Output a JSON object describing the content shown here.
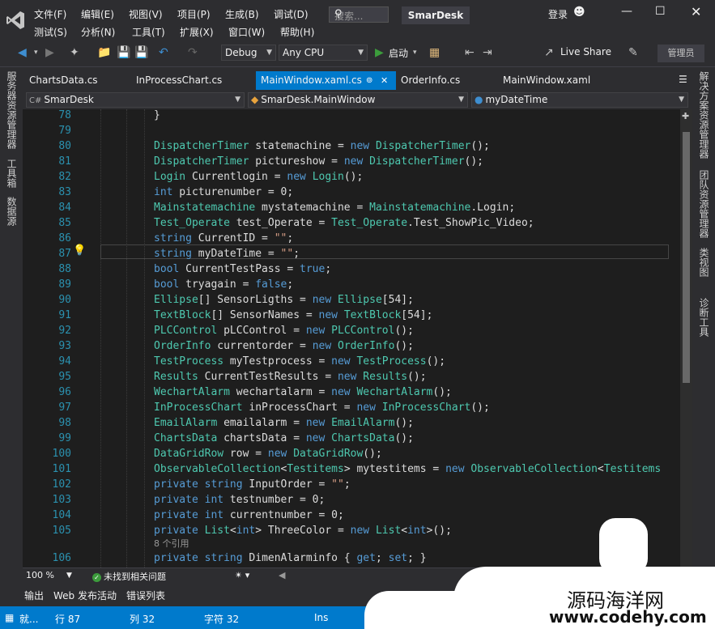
{
  "titlebar": {
    "menu_row1": [
      "文件(F)",
      "编辑(E)",
      "视图(V)",
      "项目(P)",
      "生成(B)",
      "调试(D)"
    ],
    "menu_row2": [
      "测试(S)",
      "分析(N)",
      "工具(T)",
      "扩展(X)",
      "窗口(W)",
      "帮助(H)"
    ],
    "search_placeholder": "搜索...",
    "app_title": "SmarDesk",
    "login": "登录"
  },
  "toolbar": {
    "config": "Debug",
    "platform": "Any CPU",
    "start_label": "启动",
    "live_share": "Live Share",
    "admin": "管理员"
  },
  "left_panels": [
    "服务器资源管理器",
    "工具箱",
    "数据源"
  ],
  "right_panels": [
    "解决方案资源管理器",
    "团队资源管理器",
    "类视图",
    "诊断工具"
  ],
  "tabs": [
    {
      "label": "ChartsData.cs"
    },
    {
      "label": "InProcessChart.cs"
    },
    {
      "label": "MainWindow.xaml.cs",
      "active": true
    },
    {
      "label": "OrderInfo.cs"
    },
    {
      "label": "MainWindow.xaml"
    }
  ],
  "navbar": {
    "project": "SmarDesk",
    "class": "SmarDesk.MainWindow",
    "member": "myDateTime"
  },
  "codelens": "8 个引用",
  "code_lines": [
    {
      "n": "78",
      "tokens": [
        [
          "p",
          "}"
        ]
      ]
    },
    {
      "n": "79",
      "tokens": []
    },
    {
      "n": "80",
      "tokens": [
        [
          "t",
          "DispatcherTimer"
        ],
        [
          "p",
          " statemachine = "
        ],
        [
          "k",
          "new"
        ],
        [
          "p",
          " "
        ],
        [
          "t",
          "DispatcherTimer"
        ],
        [
          "p",
          "();"
        ]
      ]
    },
    {
      "n": "81",
      "tokens": [
        [
          "t",
          "DispatcherTimer"
        ],
        [
          "p",
          " pictureshow = "
        ],
        [
          "k",
          "new"
        ],
        [
          "p",
          " "
        ],
        [
          "t",
          "DispatcherTimer"
        ],
        [
          "p",
          "();"
        ]
      ]
    },
    {
      "n": "82",
      "tokens": [
        [
          "t",
          "Login"
        ],
        [
          "p",
          " Currentlogin = "
        ],
        [
          "k",
          "new"
        ],
        [
          "p",
          " "
        ],
        [
          "t",
          "Login"
        ],
        [
          "p",
          "();"
        ]
      ]
    },
    {
      "n": "83",
      "tokens": [
        [
          "k",
          "int"
        ],
        [
          "p",
          " picturenumber = 0;"
        ]
      ]
    },
    {
      "n": "84",
      "tokens": [
        [
          "t",
          "Mainstatemachine"
        ],
        [
          "p",
          " mystatemachine = "
        ],
        [
          "t",
          "Mainstatemachine"
        ],
        [
          "p",
          ".Login;"
        ]
      ]
    },
    {
      "n": "85",
      "tokens": [
        [
          "t",
          "Test_Operate"
        ],
        [
          "p",
          " test_Operate = "
        ],
        [
          "t",
          "Test_Operate"
        ],
        [
          "p",
          ".Test_ShowPic_Video;"
        ]
      ]
    },
    {
      "n": "86",
      "tokens": [
        [
          "k",
          "string"
        ],
        [
          "p",
          " CurrentID = "
        ],
        [
          "s",
          "\"\""
        ],
        [
          "p",
          ";"
        ]
      ]
    },
    {
      "n": "87",
      "tokens": [
        [
          "k",
          "string"
        ],
        [
          "p",
          " myDateTime = "
        ],
        [
          "s",
          "\"\""
        ],
        [
          "p",
          ";"
        ]
      ]
    },
    {
      "n": "88",
      "tokens": [
        [
          "k",
          "bool"
        ],
        [
          "p",
          " CurrentTestPass = "
        ],
        [
          "k",
          "true"
        ],
        [
          "p",
          ";"
        ]
      ]
    },
    {
      "n": "89",
      "tokens": [
        [
          "k",
          "bool"
        ],
        [
          "p",
          " tryagain = "
        ],
        [
          "k",
          "false"
        ],
        [
          "p",
          ";"
        ]
      ]
    },
    {
      "n": "90",
      "tokens": [
        [
          "t",
          "Ellipse"
        ],
        [
          "p",
          "[] SensorLigths = "
        ],
        [
          "k",
          "new"
        ],
        [
          "p",
          " "
        ],
        [
          "t",
          "Ellipse"
        ],
        [
          "p",
          "[54];"
        ]
      ]
    },
    {
      "n": "91",
      "tokens": [
        [
          "t",
          "TextBlock"
        ],
        [
          "p",
          "[] SensorNames = "
        ],
        [
          "k",
          "new"
        ],
        [
          "p",
          " "
        ],
        [
          "t",
          "TextBlock"
        ],
        [
          "p",
          "[54];"
        ]
      ]
    },
    {
      "n": "92",
      "tokens": [
        [
          "t",
          "PLCControl"
        ],
        [
          "p",
          " pLCControl = "
        ],
        [
          "k",
          "new"
        ],
        [
          "p",
          " "
        ],
        [
          "t",
          "PLCControl"
        ],
        [
          "p",
          "();"
        ]
      ]
    },
    {
      "n": "93",
      "tokens": [
        [
          "t",
          "OrderInfo"
        ],
        [
          "p",
          " currentorder = "
        ],
        [
          "k",
          "new"
        ],
        [
          "p",
          " "
        ],
        [
          "t",
          "OrderInfo"
        ],
        [
          "p",
          "();"
        ]
      ]
    },
    {
      "n": "94",
      "tokens": [
        [
          "t",
          "TestProcess"
        ],
        [
          "p",
          " myTestprocess = "
        ],
        [
          "k",
          "new"
        ],
        [
          "p",
          " "
        ],
        [
          "t",
          "TestProcess"
        ],
        [
          "p",
          "();"
        ]
      ]
    },
    {
      "n": "95",
      "tokens": [
        [
          "t",
          "Results"
        ],
        [
          "p",
          " CurrentTestResults = "
        ],
        [
          "k",
          "new"
        ],
        [
          "p",
          " "
        ],
        [
          "t",
          "Results"
        ],
        [
          "p",
          "();"
        ]
      ]
    },
    {
      "n": "96",
      "tokens": [
        [
          "t",
          "WechartAlarm"
        ],
        [
          "p",
          " wechartalarm = "
        ],
        [
          "k",
          "new"
        ],
        [
          "p",
          " "
        ],
        [
          "t",
          "WechartAlarm"
        ],
        [
          "p",
          "();"
        ]
      ]
    },
    {
      "n": "97",
      "tokens": [
        [
          "t",
          "InProcessChart"
        ],
        [
          "p",
          " inProcessChart = "
        ],
        [
          "k",
          "new"
        ],
        [
          "p",
          " "
        ],
        [
          "t",
          "InProcessChart"
        ],
        [
          "p",
          "();"
        ]
      ]
    },
    {
      "n": "98",
      "tokens": [
        [
          "t",
          "EmailAlarm"
        ],
        [
          "p",
          " emailalarm = "
        ],
        [
          "k",
          "new"
        ],
        [
          "p",
          " "
        ],
        [
          "t",
          "EmailAlarm"
        ],
        [
          "p",
          "();"
        ]
      ]
    },
    {
      "n": "99",
      "tokens": [
        [
          "t",
          "ChartsData"
        ],
        [
          "p",
          " chartsData = "
        ],
        [
          "k",
          "new"
        ],
        [
          "p",
          " "
        ],
        [
          "t",
          "ChartsData"
        ],
        [
          "p",
          "();"
        ]
      ]
    },
    {
      "n": "100",
      "tokens": [
        [
          "t",
          "DataGridRow"
        ],
        [
          "p",
          " row = "
        ],
        [
          "k",
          "new"
        ],
        [
          "p",
          " "
        ],
        [
          "t",
          "DataGridRow"
        ],
        [
          "p",
          "();"
        ]
      ]
    },
    {
      "n": "101",
      "tokens": [
        [
          "t",
          "ObservableCollection"
        ],
        [
          "p",
          "<"
        ],
        [
          "t",
          "Testitems"
        ],
        [
          "p",
          "> mytestitems = "
        ],
        [
          "k",
          "new"
        ],
        [
          "p",
          " "
        ],
        [
          "t",
          "ObservableCollection"
        ],
        [
          "p",
          "<"
        ],
        [
          "t",
          "Testitems"
        ]
      ]
    },
    {
      "n": "102",
      "tokens": [
        [
          "k",
          "private"
        ],
        [
          "p",
          " "
        ],
        [
          "k",
          "string"
        ],
        [
          "p",
          " InputOrder = "
        ],
        [
          "s",
          "\"\""
        ],
        [
          "p",
          ";"
        ]
      ]
    },
    {
      "n": "103",
      "tokens": [
        [
          "k",
          "private"
        ],
        [
          "p",
          " "
        ],
        [
          "k",
          "int"
        ],
        [
          "p",
          " testnumber = 0;"
        ]
      ]
    },
    {
      "n": "104",
      "tokens": [
        [
          "k",
          "private"
        ],
        [
          "p",
          " "
        ],
        [
          "k",
          "int"
        ],
        [
          "p",
          " currentnumber = 0;"
        ]
      ]
    },
    {
      "n": "105",
      "tokens": [
        [
          "k",
          "private"
        ],
        [
          "p",
          " "
        ],
        [
          "t",
          "List"
        ],
        [
          "p",
          "<"
        ],
        [
          "k",
          "int"
        ],
        [
          "p",
          "> ThreeColor = "
        ],
        [
          "k",
          "new"
        ],
        [
          "p",
          " "
        ],
        [
          "t",
          "List"
        ],
        [
          "p",
          "<"
        ],
        [
          "k",
          "int"
        ],
        [
          "p",
          ">();"
        ]
      ]
    },
    {
      "n": "106",
      "tokens": [
        [
          "k",
          "private"
        ],
        [
          "p",
          " "
        ],
        [
          "k",
          "string"
        ],
        [
          "p",
          " DimenAlarminfo { "
        ],
        [
          "k",
          "get"
        ],
        [
          "p",
          "; "
        ],
        [
          "k",
          "set"
        ],
        [
          "p",
          "; }"
        ]
      ]
    }
  ],
  "editor_status": {
    "zoom": "100 %",
    "issues": "未找到相关问题"
  },
  "output_tabs": [
    "输出",
    "Web 发布活动",
    "错误列表"
  ],
  "statusbar": {
    "state": "就...",
    "line": "行 87",
    "col": "列 32",
    "char": "字符 32",
    "mode": "Ins"
  },
  "watermark": {
    "line1": "源码海洋网",
    "line2": "www.codehy.com"
  },
  "colors": {
    "accent": "#007acc",
    "keyword": "#569cd6",
    "type": "#4ec9b0",
    "string": "#d69d85",
    "line_number": "#2b91af"
  }
}
